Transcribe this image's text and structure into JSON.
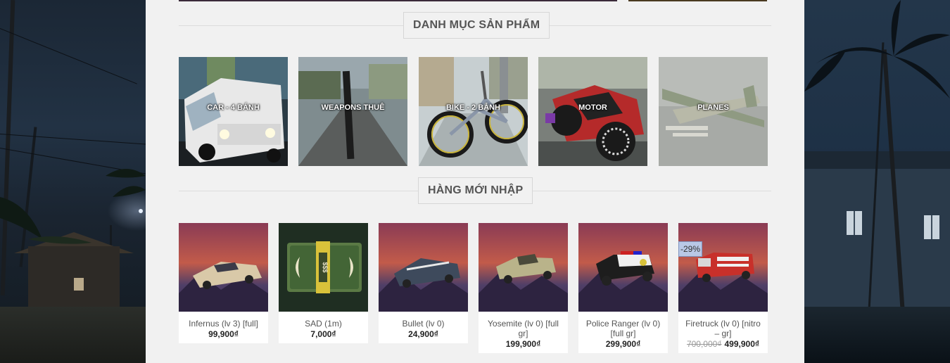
{
  "categories_section": {
    "title": "DANH MỤC SẢN PHẨM",
    "items": [
      {
        "label": "CAR - 4 BÁNH",
        "icon": "van-image"
      },
      {
        "label": "WEAPONS THUÊ",
        "icon": "street-weapon-image"
      },
      {
        "label": "BIKE - 2 BÁNH",
        "icon": "bicycle-image"
      },
      {
        "label": "MOTOR",
        "icon": "motorcycle-image"
      },
      {
        "label": "PLANES",
        "icon": "plane-image"
      }
    ]
  },
  "new_products_section": {
    "title": "HÀNG MỚI NHẬP",
    "products": [
      {
        "name": "Infernus (lv 3) [full]",
        "price": "99,900₫",
        "old_price": "",
        "badge": "",
        "icon": "sports-car-image"
      },
      {
        "name": "SAD (1m)",
        "price": "7,000₫",
        "old_price": "",
        "badge": "",
        "icon": "money-stack-image"
      },
      {
        "name": "Bullet (lv 0)",
        "price": "24,900₫",
        "old_price": "",
        "badge": "",
        "icon": "sports-car-image"
      },
      {
        "name": "Yosemite (lv 0) [full gr]",
        "price": "199,900₫",
        "old_price": "",
        "badge": "",
        "icon": "pickup-truck-image"
      },
      {
        "name": "Police Ranger (lv 0) [full gr]",
        "price": "299,900₫",
        "old_price": "",
        "badge": "",
        "icon": "police-suv-image"
      },
      {
        "name": "Firetruck (lv 0) [nitro – gr]",
        "price": "499,900₫",
        "old_price": "700,000₫",
        "badge": "-29%",
        "icon": "firetruck-image"
      }
    ]
  },
  "colors": {
    "panel_bg": "#f1f1f1",
    "heading_text": "#555555",
    "sale_badge_bg": "#b9c8e6"
  }
}
